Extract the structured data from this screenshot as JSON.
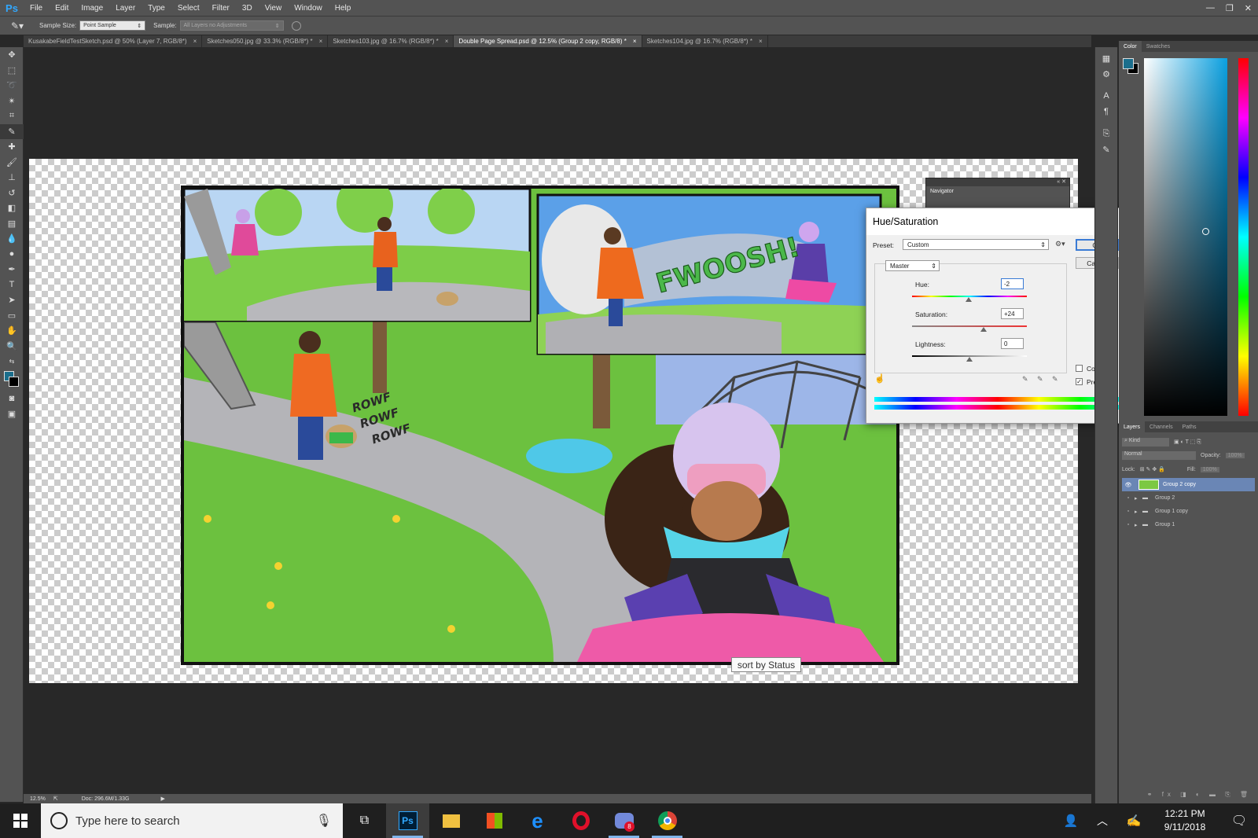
{
  "app": {
    "logo": "Ps"
  },
  "menu": [
    "File",
    "Edit",
    "Image",
    "Layer",
    "Type",
    "Select",
    "Filter",
    "3D",
    "View",
    "Window",
    "Help"
  ],
  "window_controls": {
    "minimize": "—",
    "restore": "❐",
    "close": "✕"
  },
  "options_bar": {
    "sample_size_label": "Sample Size:",
    "sample_size_value": "Point Sample",
    "sample_label": "Sample:",
    "sample_value": "All Layers no Adjustments"
  },
  "tabs": [
    {
      "label": "KusakabeFieldTestSketch.psd @ 50% (Layer 7, RGB/8*)",
      "active": false
    },
    {
      "label": "Sketches050.jpg @ 33.3% (RGB/8*) *",
      "active": false
    },
    {
      "label": "Sketches103.jpg @ 16.7% (RGB/8*) *",
      "active": false
    },
    {
      "label": "Double Page Spread.psd @ 12.5% (Group 2 copy, RGB/8) *",
      "active": true
    },
    {
      "label": "Sketches104.jpg @ 16.7% (RGB/8*) *",
      "active": false
    }
  ],
  "tab_close": "×",
  "artwork": {
    "sfx_fwoosh": "FWOOSH!",
    "sfx_rowf": [
      "ROWF",
      "ROWF",
      "ROWF"
    ]
  },
  "navigator": {
    "title": "Navigator"
  },
  "dialog": {
    "title": "Hue/Saturation",
    "close": "✕",
    "preset_label": "Preset:",
    "preset_value": "Custom",
    "ok": "OK",
    "cancel": "Cancel",
    "channel": "Master",
    "hue_label": "Hue:",
    "hue_value": "-2",
    "hue_fraction": 0.494,
    "saturation_label": "Saturation:",
    "saturation_value": "+24",
    "saturation_fraction": 0.62,
    "lightness_label": "Lightness:",
    "lightness_value": "0",
    "lightness_fraction": 0.5,
    "colorize_label": "Colorize",
    "colorize_checked": false,
    "preview_label": "Preview",
    "preview_checked": true
  },
  "tooltip": "sort by Status",
  "color_panel": {
    "tabs": [
      "Color",
      "Swatches"
    ],
    "foreground": "#1b6e8c",
    "background": "#000000"
  },
  "layers_panel": {
    "tabs": [
      "Layers",
      "Channels",
      "Paths"
    ],
    "kind": "Kind",
    "blend_mode": "Normal",
    "opacity_label": "Opacity:",
    "opacity_value": "100%",
    "lock_label": "Lock:",
    "fill_label": "Fill:",
    "fill_value": "100%",
    "layers": [
      {
        "name": "Group 2 copy",
        "selected": true,
        "visible": true
      },
      {
        "name": "Group 2",
        "selected": false,
        "visible": false
      },
      {
        "name": "Group 1 copy",
        "selected": false,
        "visible": false
      },
      {
        "name": "Group 1",
        "selected": false,
        "visible": false
      }
    ]
  },
  "status_bar": {
    "zoom": "12.5%",
    "doc": "Doc: 296.6M/1.33G"
  },
  "taskbar": {
    "search_placeholder": "Type here to search",
    "time": "12:21 PM",
    "date": "9/11/2018",
    "discord_badge": "8"
  }
}
